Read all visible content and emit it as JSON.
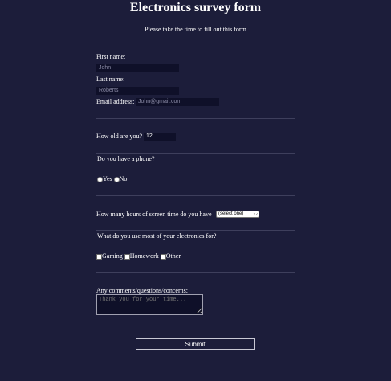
{
  "header": {
    "title": "Electronics survey form",
    "subtitle": "Please take the time to fill out this form"
  },
  "name_section": {
    "first_name_label": "First name:",
    "first_name_placeholder": "John",
    "last_name_label": "Last name:",
    "last_name_placeholder": "Roberts",
    "email_label": "Email address:",
    "email_placeholder": "John@gmail.com"
  },
  "age": {
    "label": "How old are you?",
    "value": "12"
  },
  "phone": {
    "question": "Do you have a phone?",
    "options": [
      "Yes",
      "No"
    ]
  },
  "screen_time": {
    "label": "How many hours of screen time do you have",
    "selected": "(select one)"
  },
  "usage": {
    "question": "What do you use most of your electronics for?",
    "options": [
      "Gaming",
      "Homework",
      "Other"
    ]
  },
  "comments": {
    "label": "Any comments/questions/concerns:",
    "placeholder": "Thank you for your time..."
  },
  "submit_label": "Submit"
}
